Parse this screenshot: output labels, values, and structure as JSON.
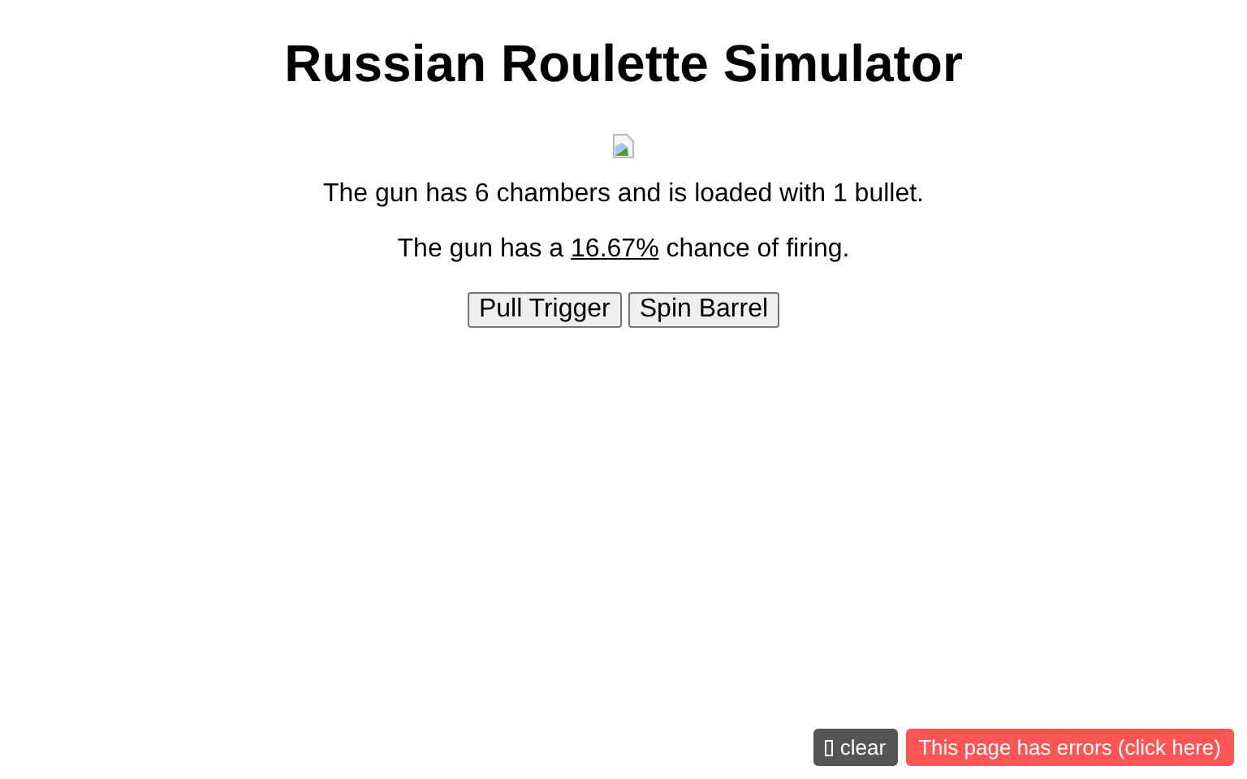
{
  "title": "Russian Roulette Simulator",
  "description": "The gun has 6 chambers and is loaded with 1 bullet.",
  "chance": {
    "before": "The gun has a ",
    "value": "16.67%",
    "after": " chance of firing."
  },
  "buttons": [
    "Pull Trigger",
    "Spin Barrel"
  ],
  "error_bar": {
    "clear": "clear",
    "message": "This page has errors (click here)"
  }
}
